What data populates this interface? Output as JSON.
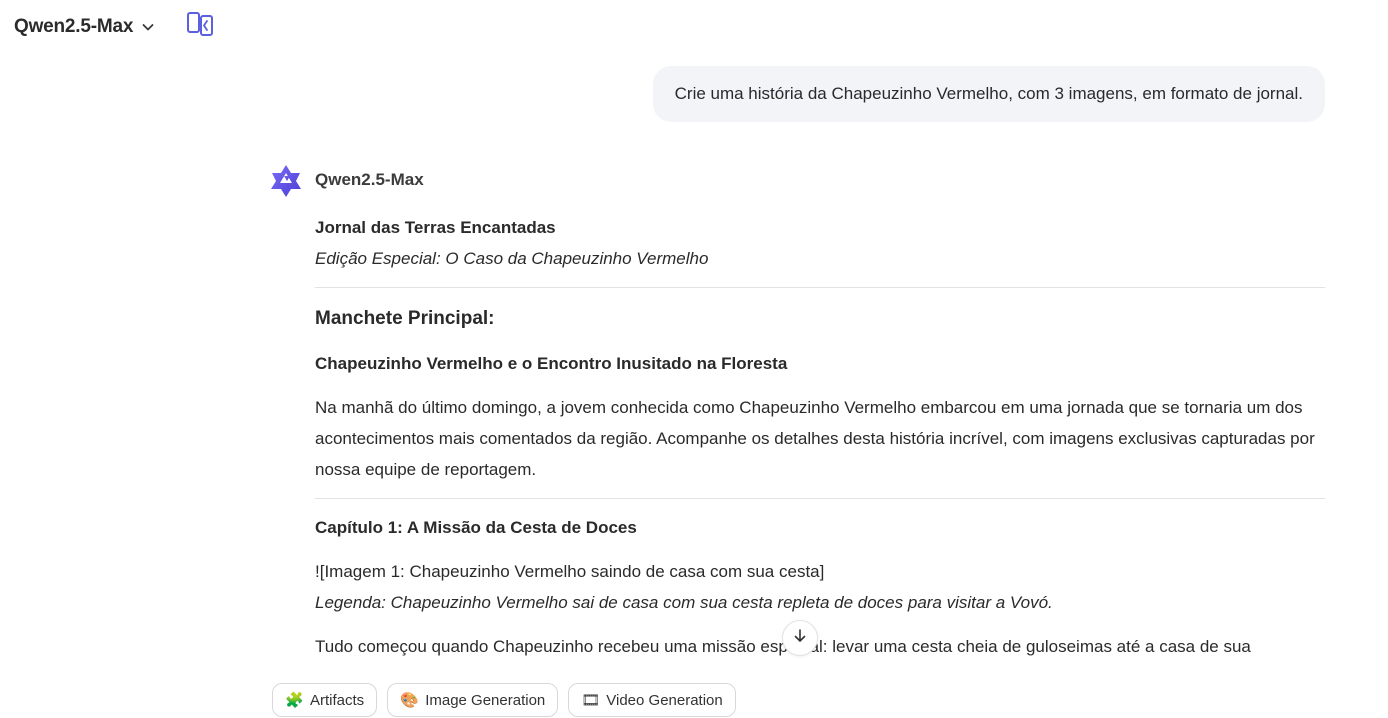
{
  "header": {
    "model_name": "Qwen2.5-Max",
    "model_dropdown_icon": "chevron-down-icon",
    "compare_icon": "split-compare-icon",
    "accent_color": "#5b5fe0"
  },
  "user_message": {
    "text": "Crie uma história da Chapeuzinho Vermelho, com 3 imagens, em formato de jornal."
  },
  "assistant": {
    "name": "Qwen2.5-Max",
    "logo_icon": "qwen-logo-icon",
    "title": "Jornal das Terras Encantadas",
    "subtitle": "Edição Especial: O Caso da Chapeuzinho Vermelho",
    "headline_label": "Manchete Principal:",
    "headline": "Chapeuzinho Vermelho e o Encontro Inusitado na Floresta",
    "intro": "Na manhã do último domingo, a jovem conhecida como Chapeuzinho Vermelho embarcou em uma jornada que se tornaria um dos acontecimentos mais comentados da região. Acompanhe os detalhes desta história incrível, com imagens exclusivas capturadas por nossa equipe de reportagem.",
    "chapter1_title": "Capítulo 1: A Missão da Cesta de Doces",
    "image1": "![Imagem 1: Chapeuzinho Vermelho saindo de casa com sua cesta]",
    "caption1": "Legenda: Chapeuzinho Vermelho sai de casa com sua cesta repleta de doces para visitar a Vovó.",
    "paragraph1": "Tudo começou quando Chapeuzinho recebeu uma missão especial: levar uma cesta cheia de guloseimas até a casa de sua"
  },
  "scroll_button": {
    "icon": "arrow-down-icon"
  },
  "chips": [
    {
      "label": "Artifacts",
      "icon": "puzzle-icon",
      "glyph": "🧩"
    },
    {
      "label": "Image Generation",
      "icon": "palette-icon",
      "glyph": "🎨"
    },
    {
      "label": "Video Generation",
      "icon": "film-icon",
      "glyph": "🎞"
    }
  ]
}
